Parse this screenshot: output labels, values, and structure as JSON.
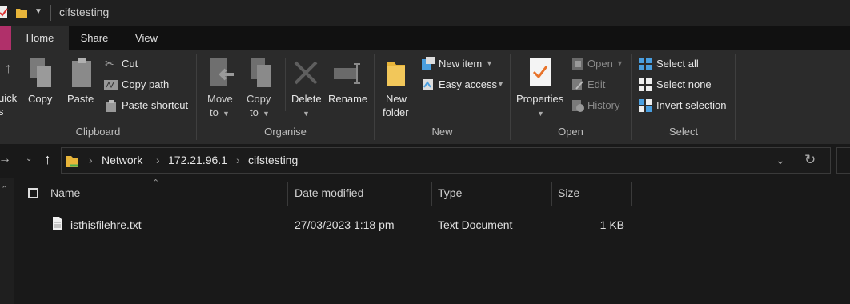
{
  "window": {
    "title": "cifstesting"
  },
  "ribbon_tabs": [
    "Home",
    "Share",
    "View"
  ],
  "clipboard": {
    "quick_access_line1": "uick",
    "quick_access_line2": "s",
    "copy": "Copy",
    "paste": "Paste",
    "cut": "Cut",
    "copy_path": "Copy path",
    "paste_shortcut": "Paste shortcut",
    "group_label": "Clipboard"
  },
  "organise": {
    "move_to_line1": "Move",
    "move_to_line2": "to",
    "copy_to_line1": "Copy",
    "copy_to_line2": "to",
    "delete": "Delete",
    "rename": "Rename",
    "group_label": "Organise"
  },
  "new_group": {
    "new_folder_line1": "New",
    "new_folder_line2": "folder",
    "new_item": "New item",
    "easy_access": "Easy access",
    "group_label": "New"
  },
  "open_group": {
    "properties": "Properties",
    "open": "Open",
    "edit": "Edit",
    "history": "History",
    "group_label": "Open"
  },
  "select_group": {
    "select_all": "Select all",
    "select_none": "Select none",
    "invert_selection": "Invert selection",
    "group_label": "Select"
  },
  "address": {
    "crumbs": [
      "Network",
      "172.21.96.1",
      "cifstesting"
    ]
  },
  "columns": {
    "name": "Name",
    "date_modified": "Date modified",
    "type": "Type",
    "size": "Size"
  },
  "files": [
    {
      "name": "isthisfilehre.txt",
      "date_modified": "27/03/2023 1:18 pm",
      "type": "Text Document",
      "size": "1 KB"
    }
  ],
  "colors": {
    "background": "#191919",
    "ribbon": "#2b2b2b",
    "accent_pink": "#b0306a",
    "folder_yellow": "#e8b53a",
    "check_orange": "#e8732a",
    "select_blue": "#4a9fe0"
  }
}
